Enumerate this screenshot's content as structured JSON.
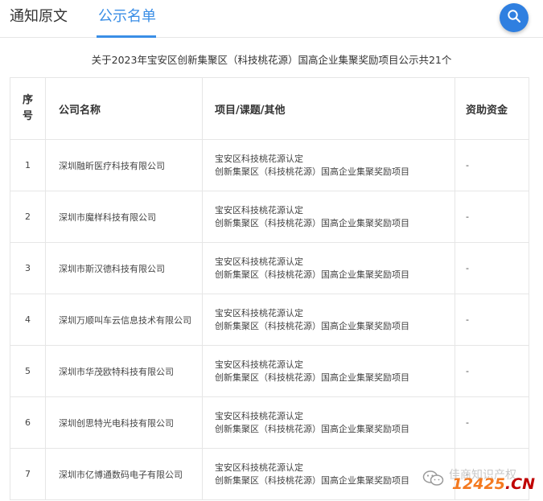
{
  "tabs": [
    {
      "label": "通知原文"
    },
    {
      "label": "公示名单"
    }
  ],
  "caption": "关于2023年宝安区创新集聚区（科技桃花源）国高企业集聚奖励项目公示共21个",
  "table": {
    "headers": {
      "no": "序号",
      "company": "公司名称",
      "project": "项目/课题/其他",
      "funding": "资助资金"
    },
    "rows": [
      {
        "no": "1",
        "company": "深圳融昕医疗科技有限公司",
        "project_line1": "宝安区科技桃花源认定",
        "project_line2": "创新集聚区（科技桃花源）国高企业集聚奖励项目",
        "funding": "-"
      },
      {
        "no": "2",
        "company": "深圳市魔样科技有限公司",
        "project_line1": "宝安区科技桃花源认定",
        "project_line2": "创新集聚区（科技桃花源）国高企业集聚奖励项目",
        "funding": "-"
      },
      {
        "no": "3",
        "company": "深圳市斯汉德科技有限公司",
        "project_line1": "宝安区科技桃花源认定",
        "project_line2": "创新集聚区（科技桃花源）国高企业集聚奖励项目",
        "funding": "-"
      },
      {
        "no": "4",
        "company": "深圳万顺叫车云信息技术有限公司",
        "project_line1": "宝安区科技桃花源认定",
        "project_line2": "创新集聚区（科技桃花源）国高企业集聚奖励项目",
        "funding": "-"
      },
      {
        "no": "5",
        "company": "深圳市华茂欧特科技有限公司",
        "project_line1": "宝安区科技桃花源认定",
        "project_line2": "创新集聚区（科技桃花源）国高企业集聚奖励项目",
        "funding": "-"
      },
      {
        "no": "6",
        "company": "深圳创思特光电科技有限公司",
        "project_line1": "宝安区科技桃花源认定",
        "project_line2": "创新集聚区（科技桃花源）国高企业集聚奖励项目",
        "funding": "-"
      },
      {
        "no": "7",
        "company": "深圳市亿博通数码电子有限公司",
        "project_line1": "宝安区科技桃花源认定",
        "project_line2": "创新集聚区（科技桃花源）国高企业集聚奖励项目",
        "funding": "-"
      }
    ]
  },
  "watermark": {
    "faded_text": "佳商知识产权",
    "brand_number": "12425",
    "brand_dot": ".",
    "brand_suffix": "CN",
    "icon": "wechat-icon"
  },
  "colors": {
    "accent": "#3a8ee6",
    "search_button": "#2f7fe0",
    "brand_orange": "#f47a20",
    "brand_red": "#c00000"
  }
}
